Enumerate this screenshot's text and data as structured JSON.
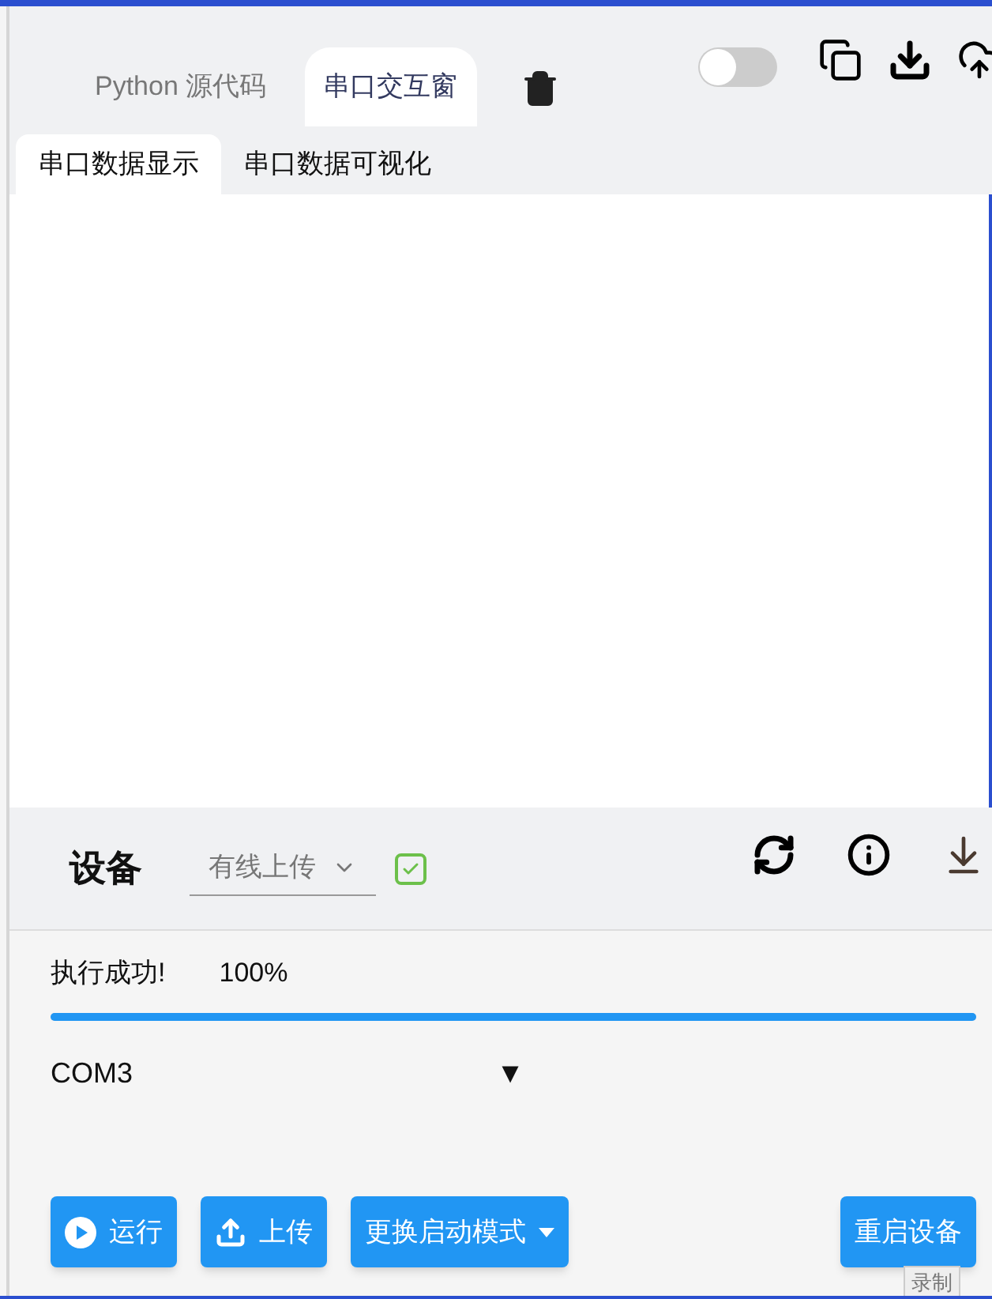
{
  "editor_tabs": [
    {
      "label": "Python 源代码",
      "selected": false
    },
    {
      "label": "串口交互窗",
      "selected": true
    }
  ],
  "toggle": {
    "on": false
  },
  "sub_tabs": [
    {
      "label": "串口数据显示",
      "selected": true
    },
    {
      "label": "串口数据可视化",
      "selected": false
    }
  ],
  "device": {
    "title": "设备",
    "upload_mode": "有线上传",
    "checked": true
  },
  "status": {
    "message": "执行成功!",
    "percent": "100%",
    "level": 1
  },
  "port": {
    "value": "COM3",
    "arrow": "▼"
  },
  "buttons": [
    {
      "kind": "run",
      "label": "运行"
    },
    {
      "kind": "upload",
      "label": "上传"
    },
    {
      "kind": "menu",
      "label": "更换启动模式"
    },
    {
      "kind": "restart",
      "label": "重启设备"
    }
  ],
  "tooltip": "录制"
}
